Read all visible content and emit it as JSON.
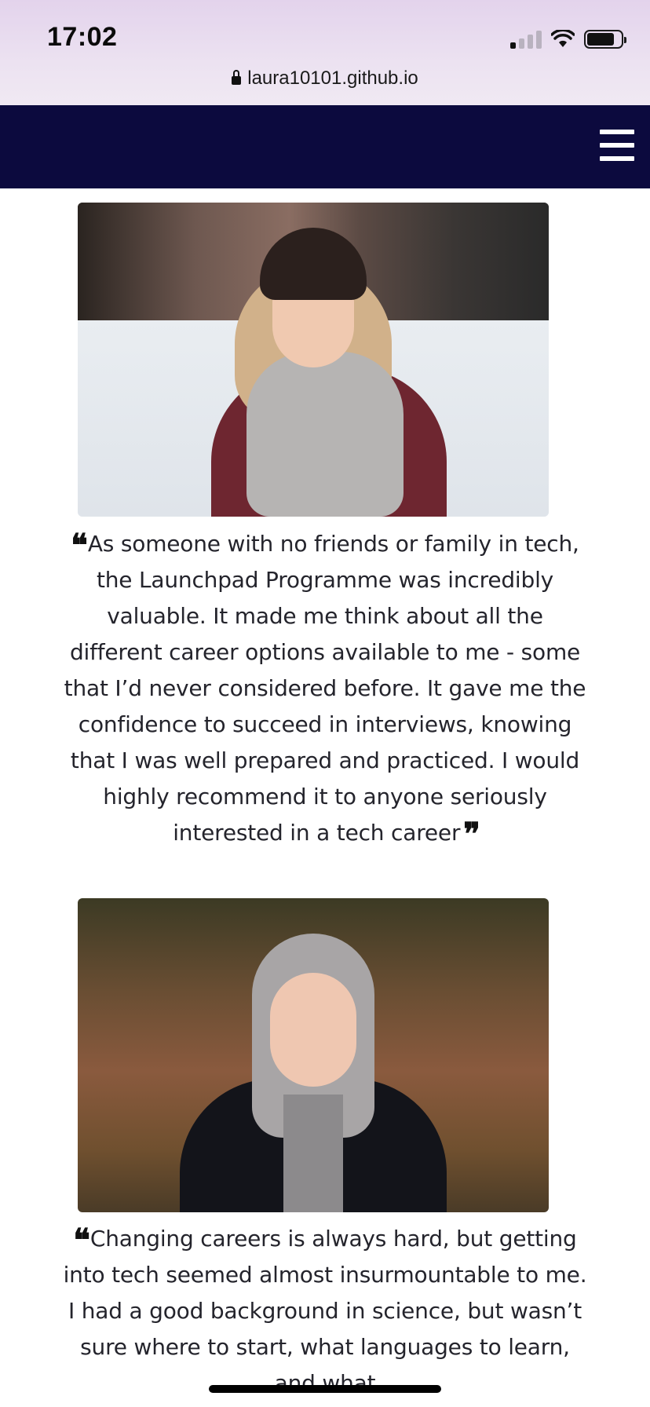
{
  "status_bar": {
    "time": "17:02"
  },
  "browser": {
    "url": "laura10101.github.io"
  },
  "colors": {
    "nav_background": "#0c0a3e",
    "text": "#24242c"
  },
  "testimonials": [
    {
      "quote": "As someone with no friends or family in tech, the Launchpad Programme was incredibly valuable. It made me think about all the different career options available to me - some that I’d never considered before. It gave me the confidence to succeed in interviews, knowing that I was well prepared and practiced. I would highly recommend it to anyone seriously interested in a tech career",
      "open_mark": "❝",
      "close_mark": "❞"
    },
    {
      "quote": "Changing careers is always hard, but getting into tech seemed almost insurmountable to me. I had a good background in science, but wasn’t sure where to start, what languages to learn, and what",
      "open_mark": "❝"
    }
  ]
}
